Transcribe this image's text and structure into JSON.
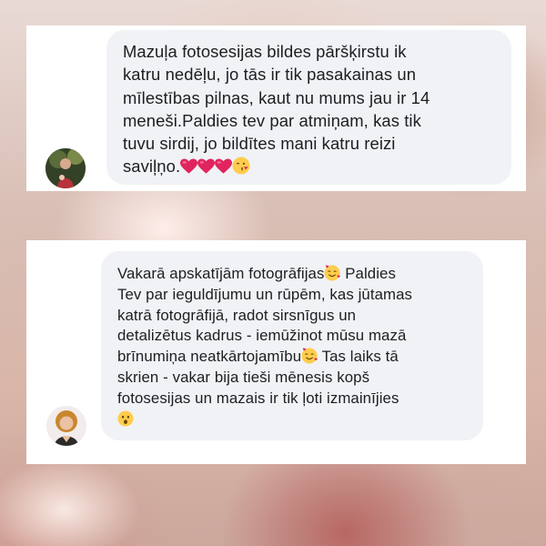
{
  "comments": [
    {
      "lines": [
        "Mazuļa fotosesijas bildes pāršķirstu ik",
        "katru nedēļu, jo tās ir tik pasakainas un",
        "mīlestības pilnas, kaut nu mums jau ir 14",
        "meneši.Paldies tev par atmiņam, kas tik",
        "tuvu sirdij, jo bildītes mani katru reizi",
        "saviļņo."
      ],
      "trailing_emojis": [
        "red-heart",
        "red-heart",
        "red-heart",
        "face-blowing-kiss"
      ]
    },
    {
      "lines": [
        "Vakarā apskatījām fotogrāfijas",
        " Paldies",
        "Tev par ieguldījumu un rūpēm, kas jūtamas",
        "katrā fotogrāfijā, radot sirsnīgus un",
        "detalizētus kadrus - iemūžinot mūsu mazā",
        "brīnumiņa neatkārtojamību",
        " Tas laiks tā",
        "skrien - vakar bija tieši mēnesis kopš",
        "fotosesijas un  mazais ir tik ļoti izmainījies"
      ],
      "emojis": [
        "smiling-face-with-hearts",
        "smiling-face-with-hearts",
        "astonished-face"
      ]
    }
  ],
  "colors": {
    "bubble": "#f0f2f5",
    "text": "#1c1e21",
    "heart": "#e0245e"
  }
}
